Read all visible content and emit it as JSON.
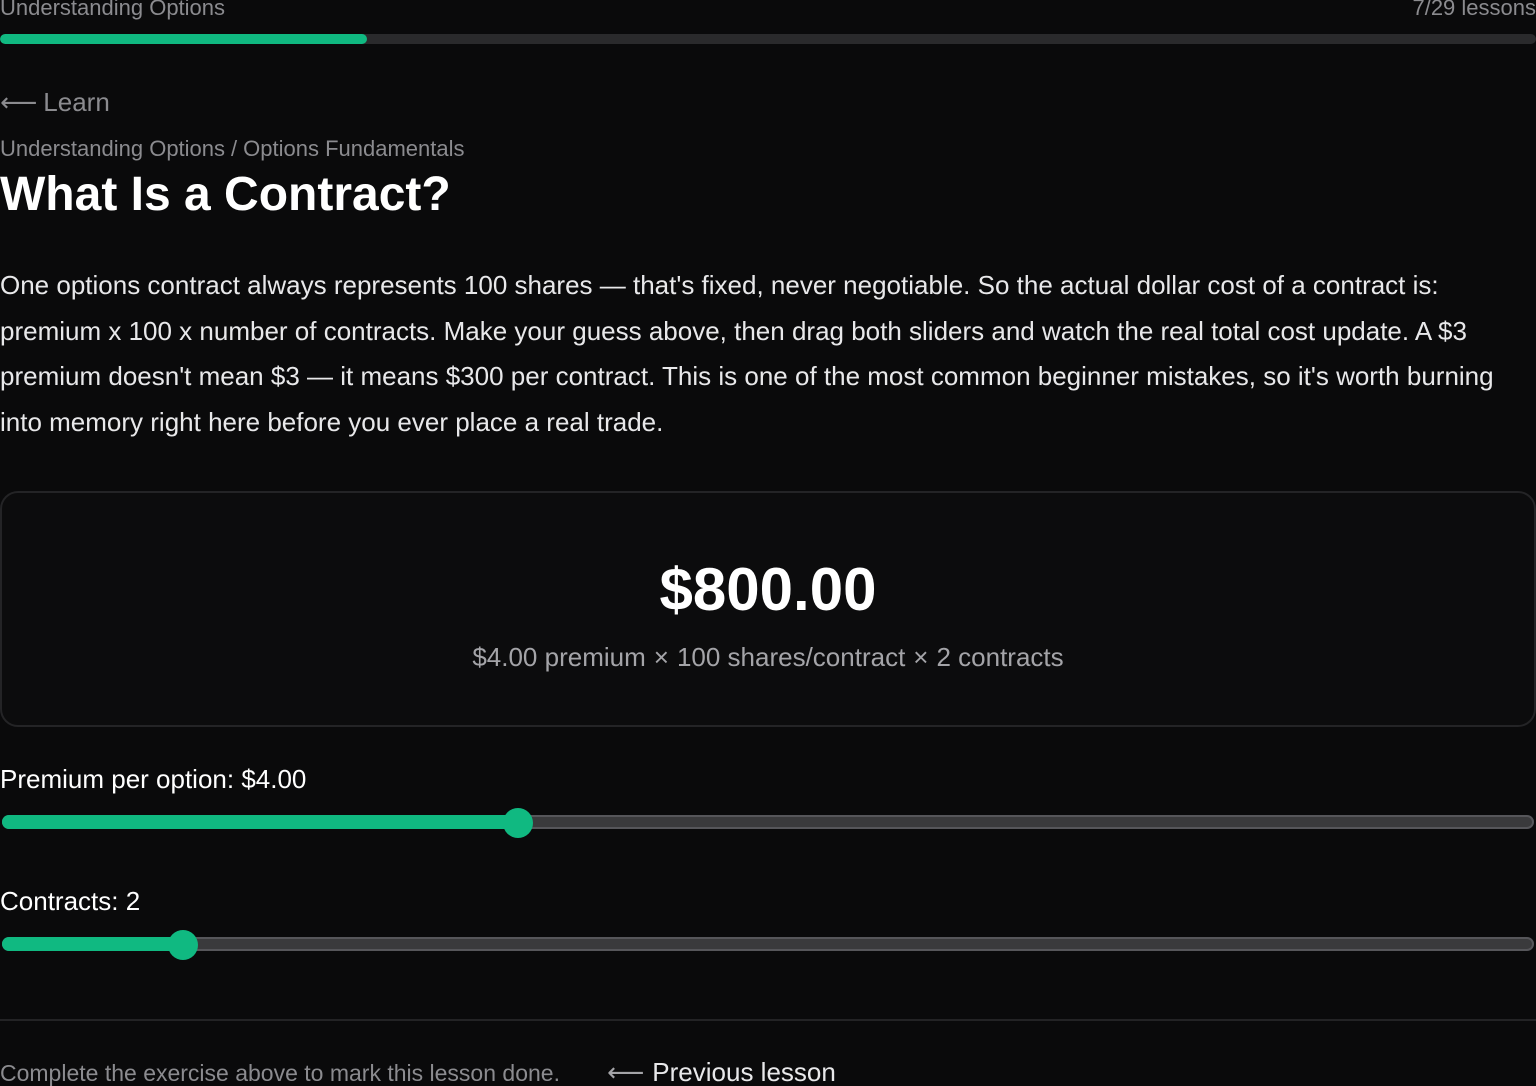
{
  "header": {
    "course_title": "Understanding Options",
    "lesson_count": "7/29 lessons",
    "progress_fraction": 0.239
  },
  "nav": {
    "back_arrow": "⟵",
    "back_label": "Learn"
  },
  "breadcrumb": {
    "course": "Understanding Options",
    "separator": "/",
    "section": "Options Fundamentals"
  },
  "lesson": {
    "title": "What Is a Contract?",
    "body": "One options contract always represents 100 shares — that's fixed, never negotiable. So the actual dollar cost of a contract is: premium x 100 x number of contracts. Make your guess above, then drag both sliders and watch the real total cost update. A $3 premium doesn't mean $3 — it means $300 per contract. This is one of the most common beginner mistakes, so it's worth burning into memory right here before you ever place a real trade."
  },
  "calculator": {
    "total": "$800.00",
    "formula_premium": "$4.00 premium",
    "formula_shares": "100 shares/contract",
    "formula_contracts": "2 contracts",
    "times_symbol": "×"
  },
  "premium_slider": {
    "label": "Premium per option: $4.00",
    "fraction": 0.337
  },
  "contracts_slider": {
    "label": "Contracts: 2",
    "fraction": 0.118
  },
  "footer": {
    "note": "Complete the exercise above to mark this lesson done.",
    "prev_arrow": "⟵",
    "prev_label": "Previous lesson"
  },
  "colors": {
    "accent": "#10b981",
    "background": "#0a0a0b",
    "muted_text": "#8b8b8f",
    "track": "#3a3a3c"
  }
}
